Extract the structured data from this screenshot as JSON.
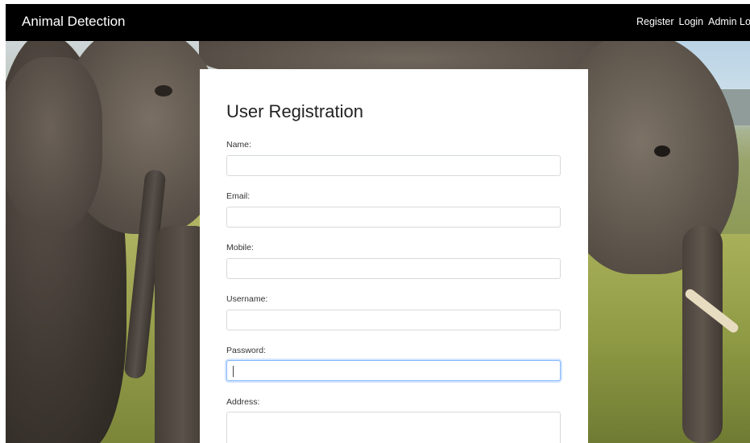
{
  "navbar": {
    "brand": "Animal Detection",
    "links": [
      "Register",
      "Login",
      "Admin Login"
    ],
    "background": "#000000"
  },
  "form": {
    "title": "User Registration",
    "fields": [
      {
        "label": "Name:",
        "value": "",
        "placeholder": ""
      },
      {
        "label": "Email:",
        "value": "",
        "placeholder": ""
      },
      {
        "label": "Mobile:",
        "value": "",
        "placeholder": ""
      },
      {
        "label": "Username:",
        "value": "",
        "placeholder": ""
      },
      {
        "label": "Password:",
        "value": "",
        "placeholder": "",
        "focused": true
      },
      {
        "label": "Address:",
        "value": "",
        "placeholder": ""
      }
    ],
    "focus_color": "#86b7fe"
  },
  "background_image": {
    "subject_icon": "elephant-photo"
  }
}
